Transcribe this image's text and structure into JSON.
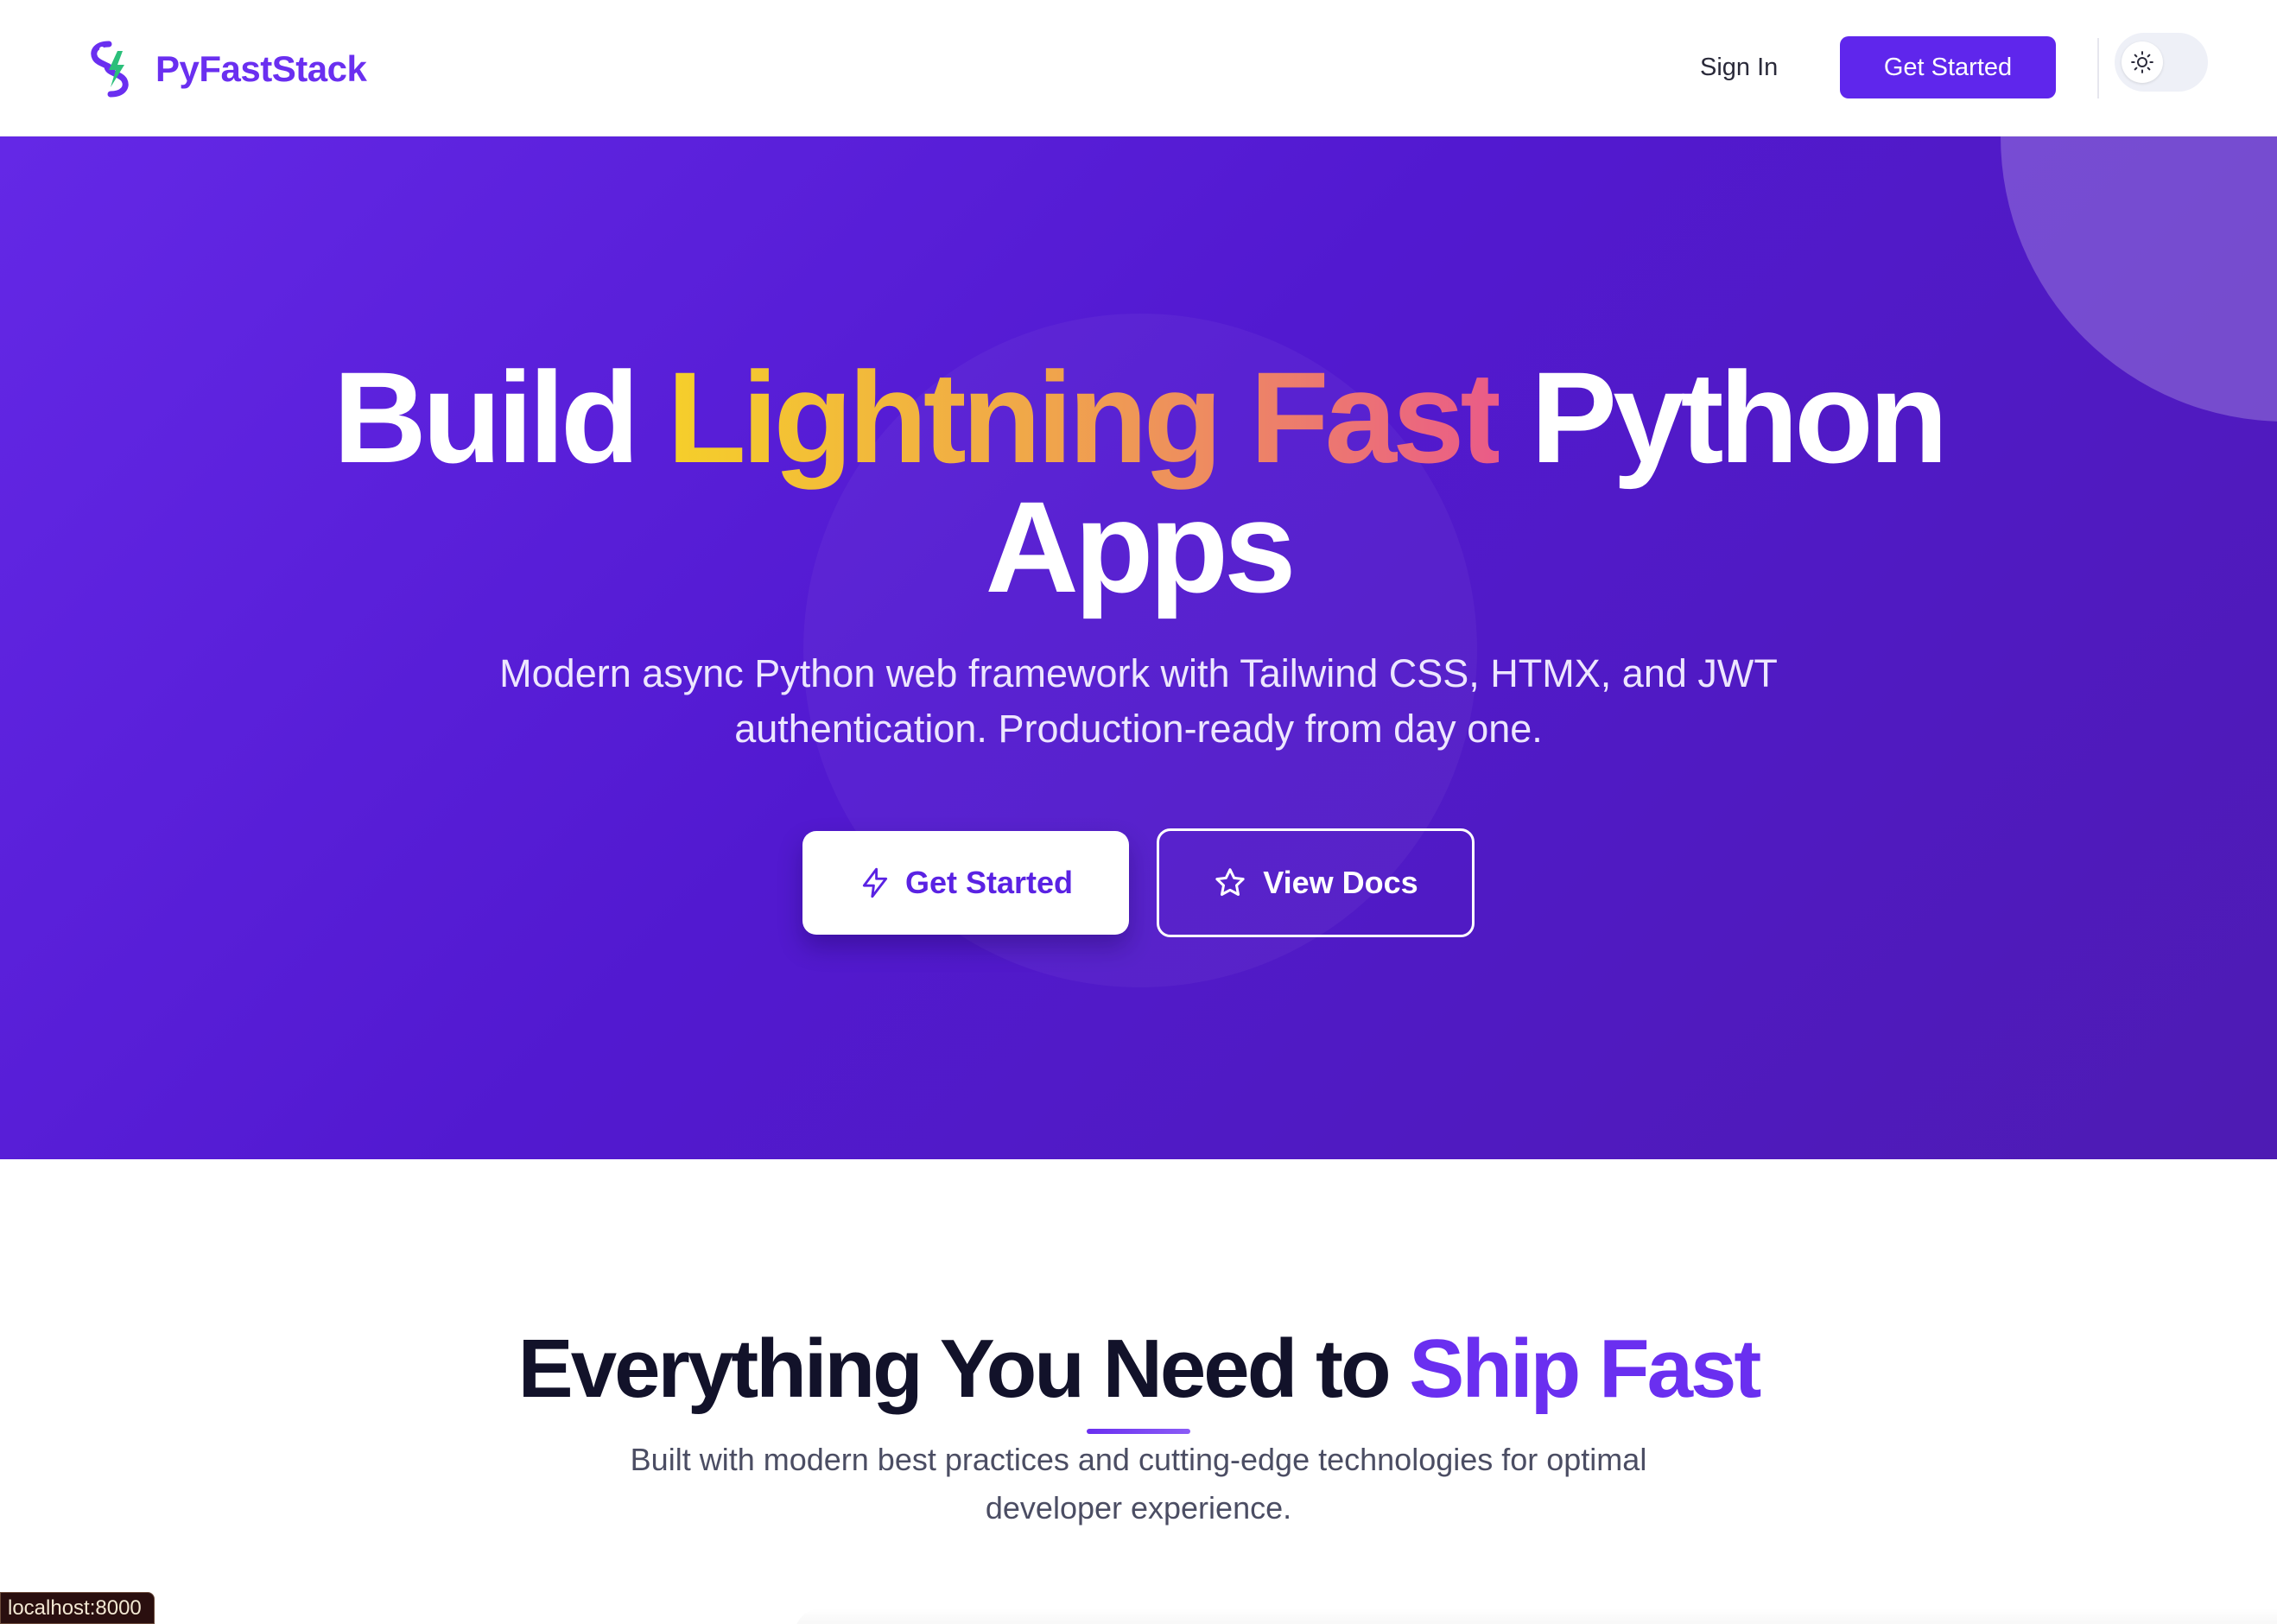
{
  "header": {
    "brand": "PyFastStack",
    "signin_label": "Sign In",
    "getstarted_label": "Get Started"
  },
  "hero": {
    "title_part1": "Build ",
    "title_highlight": "Lightning Fast",
    "title_part2": " Python",
    "title_line2": "Apps",
    "subtitle": "Modern async Python web framework with Tailwind CSS, HTMX, and JWT authentication. Production-ready from day one.",
    "cta_primary": "Get Started",
    "cta_secondary": "View Docs"
  },
  "features": {
    "title_part1": "Everything You Need to ",
    "title_accent": "Ship Fast",
    "subtitle": "Built with modern best practices and cutting-edge technologies for optimal developer experience."
  },
  "status": {
    "url": "localhost:8000"
  },
  "icons": {
    "logo": "python-bolt-logo-icon",
    "theme": "sun-icon",
    "primary_cta": "lightning-bolt-icon",
    "secondary_cta": "star-icon"
  },
  "colors": {
    "brand": "#6a2ff0",
    "hero_gradient_start": "#6428e6",
    "hero_gradient_end": "#4e1bb3",
    "highlight_yellow": "#f5cf2a",
    "highlight_pink": "#ea5b88"
  }
}
